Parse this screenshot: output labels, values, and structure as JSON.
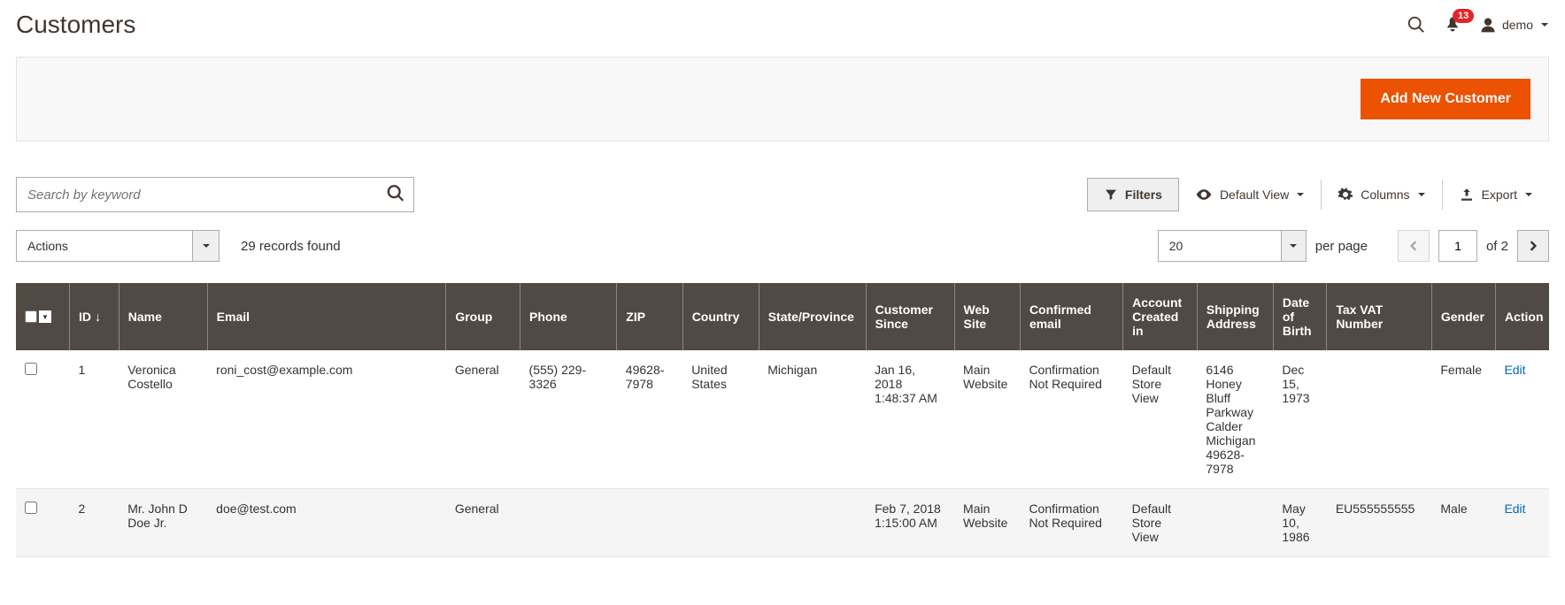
{
  "header": {
    "title": "Customers",
    "notification_count": "13",
    "username": "demo"
  },
  "action_bar": {
    "add_button": "Add New Customer"
  },
  "toolbar": {
    "search_placeholder": "Search by keyword",
    "filters_label": "Filters",
    "view_label": "Default View",
    "columns_label": "Columns",
    "export_label": "Export"
  },
  "secondary": {
    "actions_label": "Actions",
    "records_found": "29 records found",
    "per_page_value": "20",
    "per_page_label": "per page",
    "current_page": "1",
    "total_pages": "2",
    "of_label": "of"
  },
  "grid": {
    "columns": {
      "id": "ID",
      "name": "Name",
      "email": "Email",
      "group": "Group",
      "phone": "Phone",
      "zip": "ZIP",
      "country": "Country",
      "state": "State/Province",
      "since": "Customer Since",
      "website": "Web Site",
      "confirmed": "Confirmed email",
      "created_in": "Account Created in",
      "shipping": "Shipping Address",
      "dob": "Date of Birth",
      "vat": "Tax VAT Number",
      "gender": "Gender",
      "action": "Action"
    },
    "edit_label": "Edit",
    "rows": [
      {
        "id": "1",
        "name": "Veronica Costello",
        "email": "roni_cost@example.com",
        "group": "General",
        "phone": "(555) 229-3326",
        "zip": "49628-7978",
        "country": "United States",
        "state": "Michigan",
        "since": "Jan 16, 2018 1:48:37 AM",
        "website": "Main Website",
        "confirmed": "Confirmation Not Required",
        "created_in": "Default Store View",
        "shipping": "6146 Honey Bluff Parkway Calder Michigan 49628-7978",
        "dob": "Dec 15, 1973",
        "vat": "",
        "gender": "Female"
      },
      {
        "id": "2",
        "name": "Mr. John D Doe Jr.",
        "email": "doe@test.com",
        "group": "General",
        "phone": "",
        "zip": "",
        "country": "",
        "state": "",
        "since": "Feb 7, 2018 1:15:00 AM",
        "website": "Main Website",
        "confirmed": "Confirmation Not Required",
        "created_in": "Default Store View",
        "shipping": "",
        "dob": "May 10, 1986",
        "vat": "EU555555555",
        "gender": "Male"
      }
    ]
  }
}
